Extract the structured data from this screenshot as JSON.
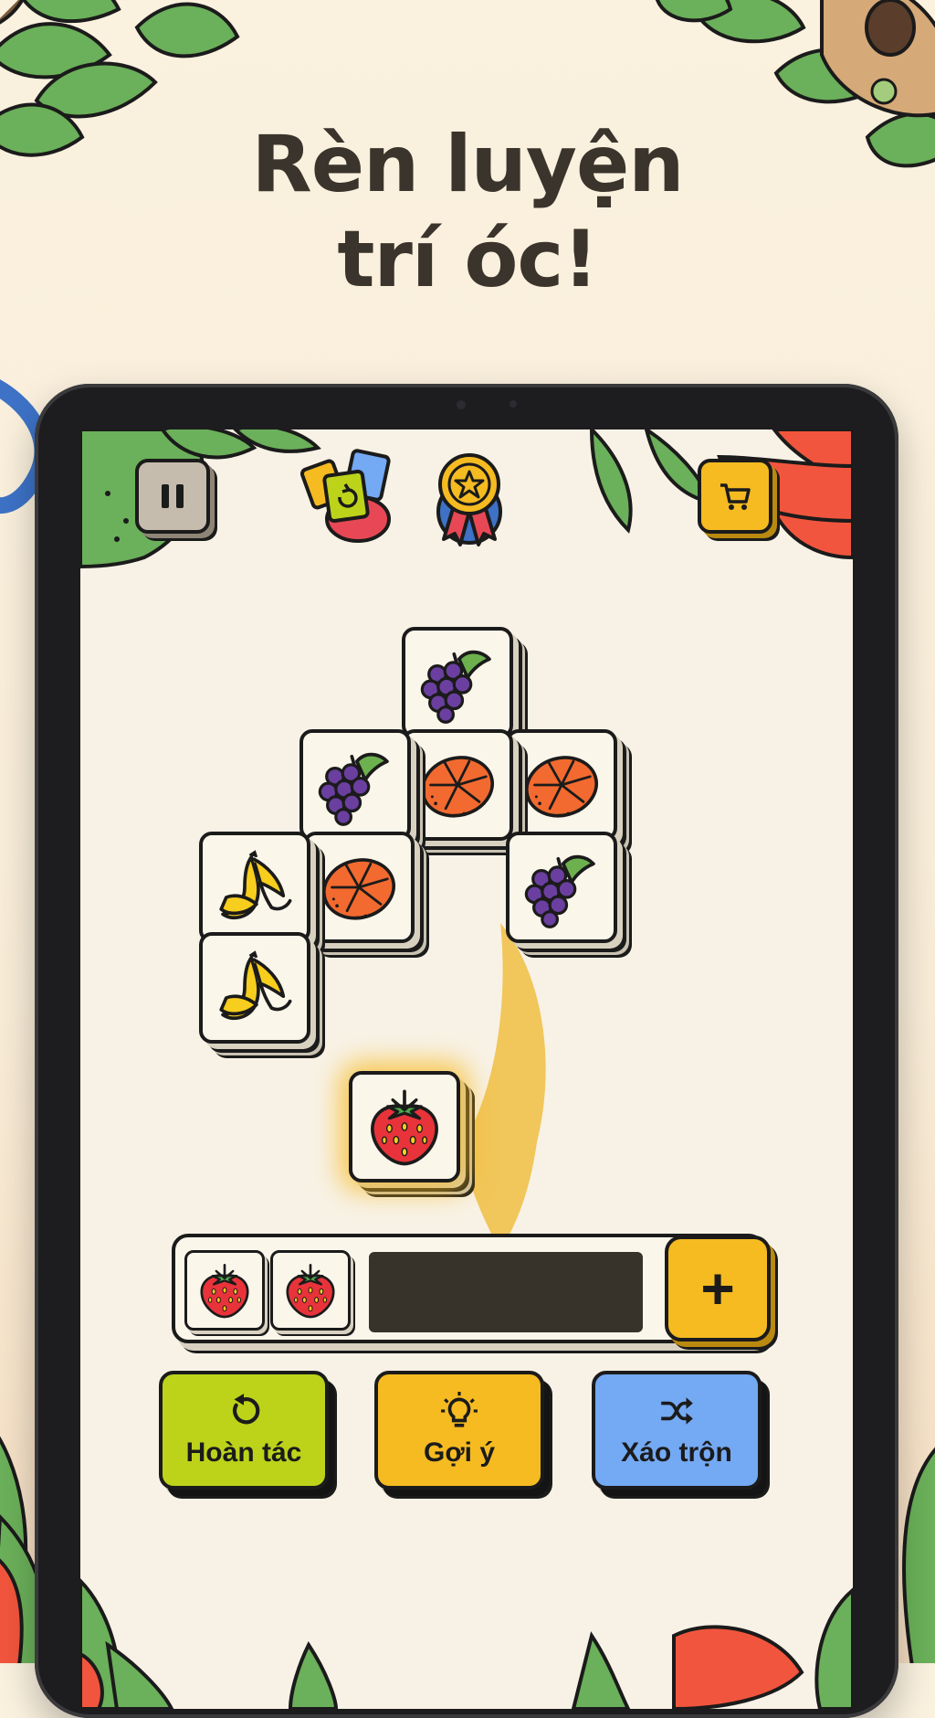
{
  "headline": {
    "line1": "Rèn luyện",
    "line2": "trí óc!"
  },
  "colors": {
    "background": "#faf1df",
    "tile_face": "#fbf6ea",
    "undo_green": "#bcd31a",
    "hint_yellow": "#f5bb21",
    "shuffle_blue": "#74a9f4",
    "leaf_green": "#6bb05a",
    "flower_red": "#f2553d"
  },
  "top_bar": {
    "pause_icon": "pause-icon",
    "cards_icon": "cards-booster-icon",
    "medal_icon": "star-medal-icon",
    "shop_icon": "cart-icon"
  },
  "board": {
    "tiles": [
      "grapes",
      "grapes",
      "orange",
      "orange",
      "banana",
      "orange",
      "grapes",
      "banana"
    ],
    "selected_tile": "strawberry"
  },
  "tray": {
    "slots": [
      "strawberry",
      "strawberry"
    ],
    "add_label": "+"
  },
  "actions": {
    "undo": {
      "label": "Hoàn tác",
      "icon": "undo-icon"
    },
    "hint": {
      "label": "Gợi ý",
      "icon": "lightbulb-icon"
    },
    "shuffle": {
      "label": "Xáo trộn",
      "icon": "shuffle-icon"
    }
  }
}
